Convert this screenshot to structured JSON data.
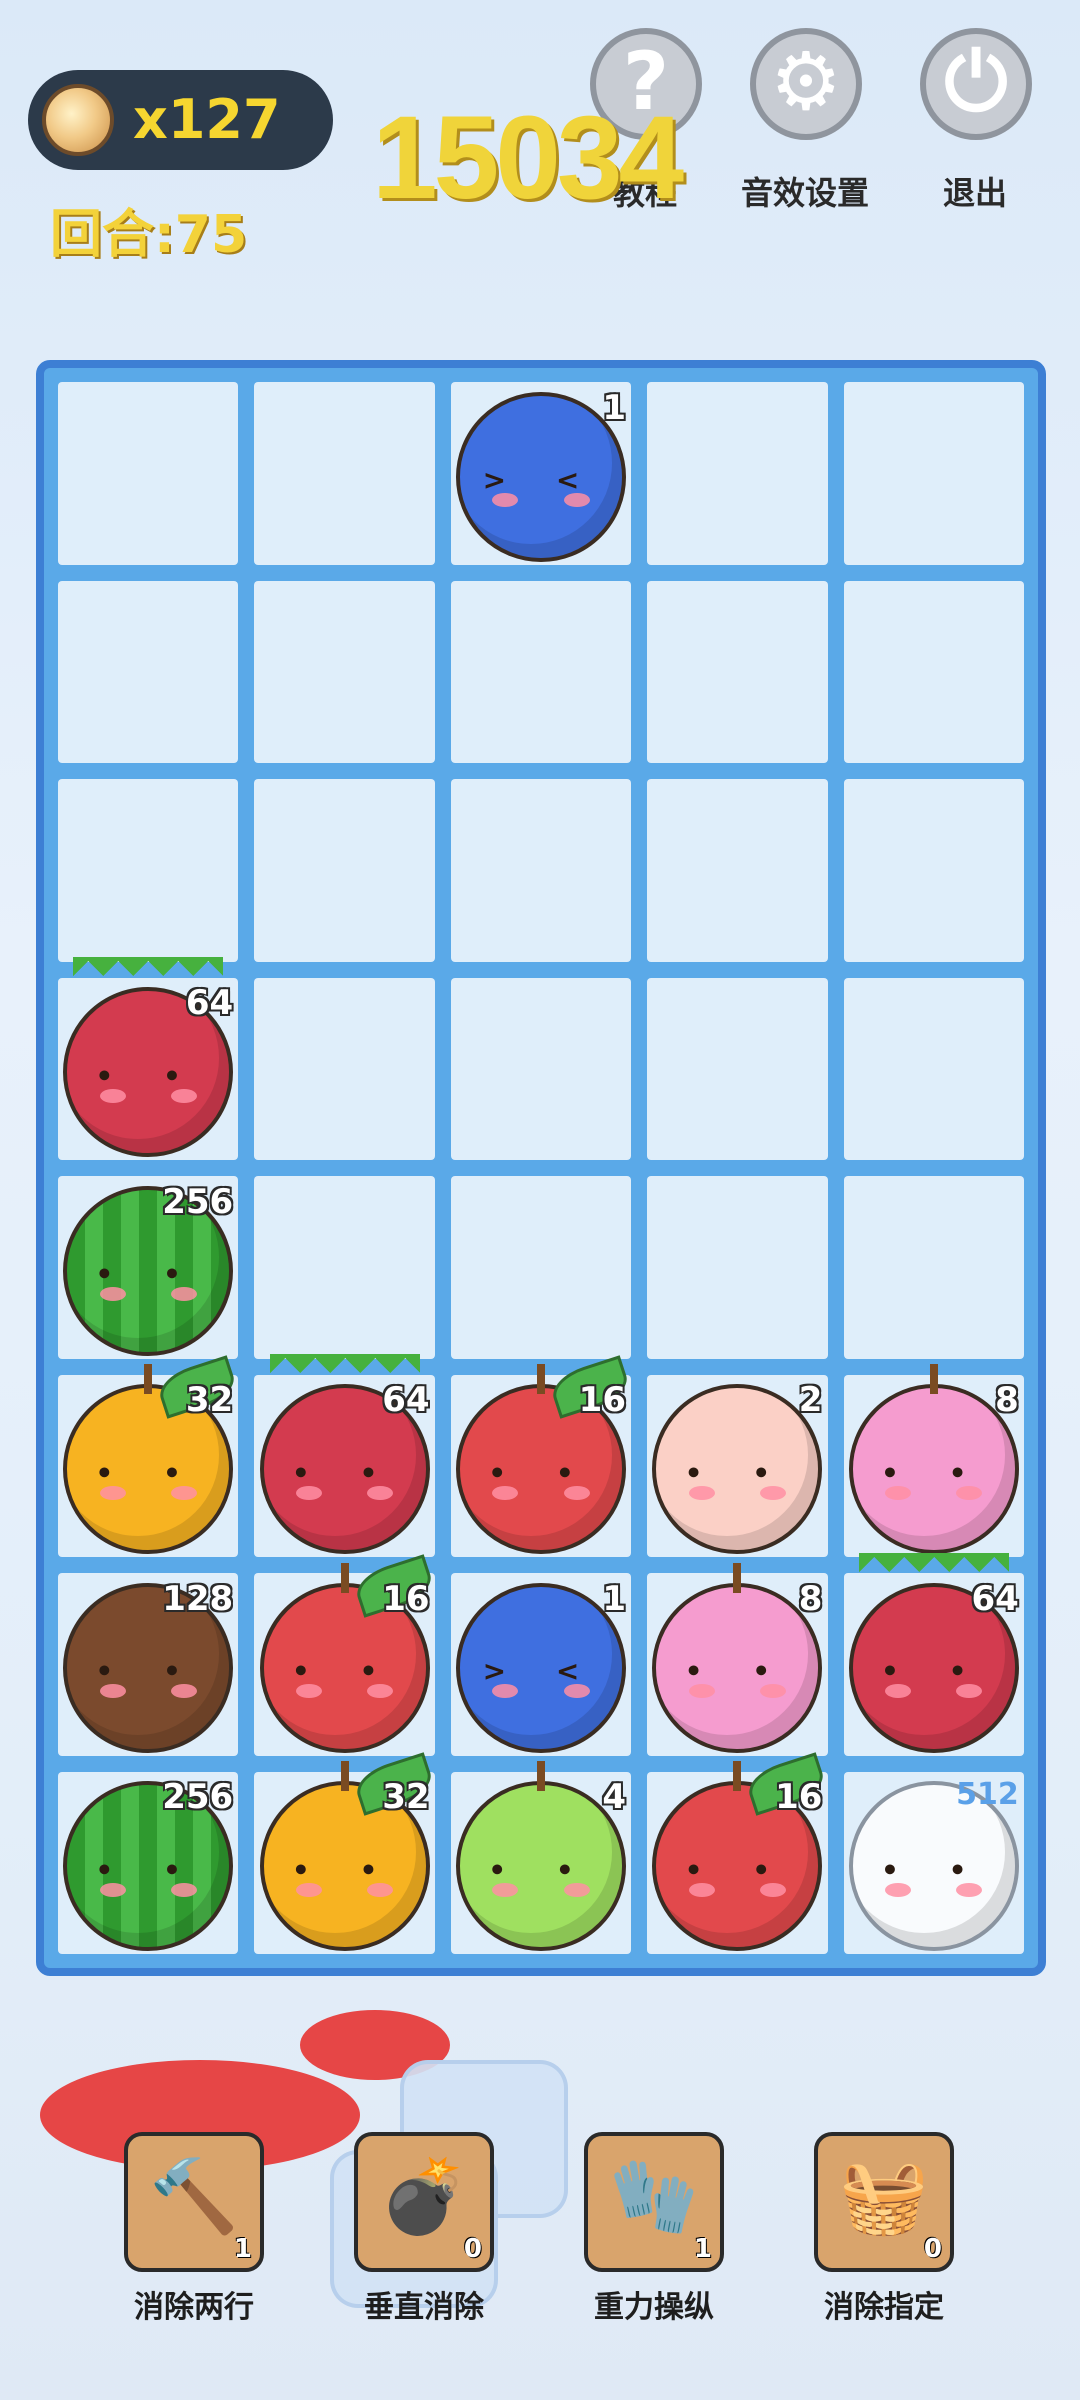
{
  "hud": {
    "coin_count": "x127",
    "score": "15034",
    "round_label": "回合:75",
    "buttons": [
      {
        "icon": "question-mark-icon",
        "label": "教程"
      },
      {
        "icon": "gear-icon",
        "label": "音效设置"
      },
      {
        "icon": "exit-icon",
        "label": "退出"
      }
    ]
  },
  "board": {
    "rows": 8,
    "cols": 5,
    "cells": [
      [
        null,
        null,
        {
          "fruit": "blueberry",
          "value": "1"
        },
        null,
        null
      ],
      [
        null,
        null,
        null,
        null,
        null
      ],
      [
        null,
        null,
        null,
        null,
        null
      ],
      [
        {
          "fruit": "dragon",
          "value": "64"
        },
        null,
        null,
        null,
        null
      ],
      [
        {
          "fruit": "watermelon",
          "value": "256"
        },
        null,
        null,
        null,
        null
      ],
      [
        {
          "fruit": "orange",
          "value": "32"
        },
        {
          "fruit": "dragon",
          "value": "64"
        },
        {
          "fruit": "apple",
          "value": "16"
        },
        {
          "fruit": "peach",
          "value": "2"
        },
        {
          "fruit": "mangosteen",
          "value": "8"
        }
      ],
      [
        {
          "fruit": "coconut",
          "value": "128"
        },
        {
          "fruit": "apple",
          "value": "16"
        },
        {
          "fruit": "blueberry",
          "value": "1"
        },
        {
          "fruit": "mangosteen",
          "value": "8"
        },
        {
          "fruit": "dragon",
          "value": "64"
        }
      ],
      [
        {
          "fruit": "watermelon",
          "value": "256"
        },
        {
          "fruit": "orange",
          "value": "32"
        },
        {
          "fruit": "greenapple",
          "value": "4"
        },
        {
          "fruit": "apple",
          "value": "16"
        },
        {
          "fruit": "white",
          "value": "512"
        }
      ]
    ]
  },
  "tools": [
    {
      "icon": "hammer-icon",
      "label": "消除两行",
      "count": "1"
    },
    {
      "icon": "bomb-icon",
      "label": "垂直消除",
      "count": "0"
    },
    {
      "icon": "glove-icon",
      "label": "重力操纵",
      "count": "1"
    },
    {
      "icon": "basket-icon",
      "label": "消除指定",
      "count": "0"
    }
  ]
}
